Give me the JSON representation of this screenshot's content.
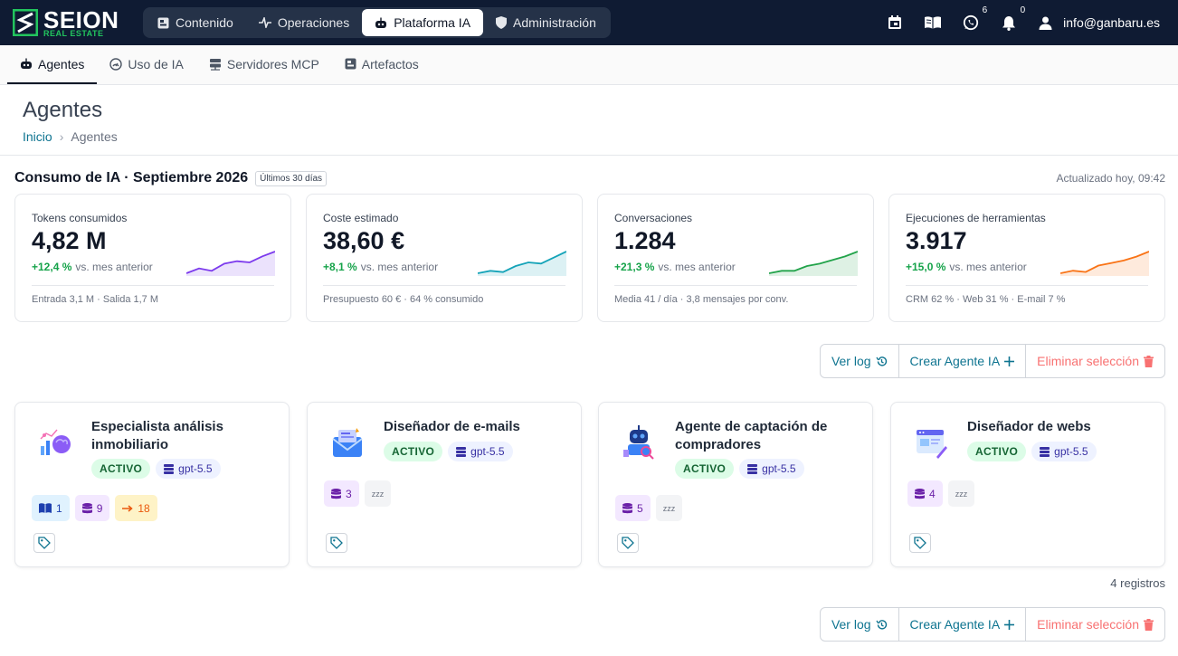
{
  "brand": {
    "name": "SEION",
    "tagline": "REAL ESTATE",
    "accent": "#22c55e"
  },
  "topnav": [
    {
      "label": "Contenido",
      "icon": "content-icon"
    },
    {
      "label": "Operaciones",
      "icon": "pulse-icon"
    },
    {
      "label": "Plataforma IA",
      "icon": "robot-icon",
      "active": true
    },
    {
      "label": "Administración",
      "icon": "shield-icon"
    }
  ],
  "topbar": {
    "whatsapp_count": "6",
    "notifications_count": "0",
    "user_email": "info@ganbaru.es"
  },
  "subnav": [
    {
      "label": "Agentes",
      "active": true
    },
    {
      "label": "Uso de IA"
    },
    {
      "label": "Servidores MCP"
    },
    {
      "label": "Artefactos"
    }
  ],
  "page": {
    "title": "Agentes",
    "breadcrumb": {
      "home": "Inicio",
      "current": "Agentes"
    }
  },
  "usage": {
    "title": "Consumo de IA · Septiembre 2026",
    "period": "Últimos 30 días",
    "updated": "Actualizado hoy, 09:42",
    "stats": [
      {
        "label": "Tokens consumidos",
        "value": "4,82 M",
        "delta": "+12,4 %",
        "delta_text": "vs. mes anterior",
        "foot": "Entrada 3,1 M · Salida 1,7 M",
        "color": "#7c3aed",
        "trend": [
          2,
          4,
          3,
          6,
          7,
          6.5,
          9,
          11
        ]
      },
      {
        "label": "Coste estimado",
        "value": "38,60 €",
        "delta": "+8,1 %",
        "delta_text": "vs. mes anterior",
        "foot": "Presupuesto 60 € · 64 % consumido",
        "color": "#14a3b8",
        "trend": [
          2,
          3,
          2.5,
          5,
          6.5,
          6,
          8.5,
          11
        ]
      },
      {
        "label": "Conversaciones",
        "value": "1.284",
        "delta": "+21,3 %",
        "delta_text": "vs. mes anterior",
        "foot": "Media 41 / día · 3,8 mensajes por conv.",
        "color": "#22a34a",
        "trend": [
          1,
          2,
          2,
          4,
          5,
          6.5,
          8,
          10
        ]
      },
      {
        "label": "Ejecuciones de herramientas",
        "value": "3.917",
        "delta": "+15,0 %",
        "delta_text": "vs. mes anterior",
        "foot": "CRM 62 % · Web 31 % · E-mail 7 %",
        "color": "#f97316",
        "trend": [
          2,
          3,
          2.5,
          5,
          6,
          7,
          8.5,
          10.5
        ]
      }
    ]
  },
  "actions": {
    "log": "Ver log",
    "create": "Crear Agente IA",
    "delete": "Eliminar selección"
  },
  "agents": [
    {
      "name": "Especialista análisis inmobiliario",
      "status": "ACTIVO",
      "model": "gpt-5.5",
      "chips": [
        {
          "type": "blue",
          "icon": "book-icon",
          "value": "1"
        },
        {
          "type": "purple",
          "icon": "database-icon",
          "value": "9"
        },
        {
          "type": "orange",
          "icon": "arrow-icon",
          "value": "18"
        }
      ]
    },
    {
      "name": "Diseñador de e-mails",
      "status": "ACTIVO",
      "model": "gpt-5.5",
      "chips": [
        {
          "type": "purple",
          "icon": "database-icon",
          "value": "3"
        },
        {
          "type": "gray",
          "icon": "sleep-icon",
          "value": "zzz"
        }
      ]
    },
    {
      "name": "Agente de captación de compradores",
      "status": "ACTIVO",
      "model": "gpt-5.5",
      "chips": [
        {
          "type": "purple",
          "icon": "database-icon",
          "value": "5"
        },
        {
          "type": "gray",
          "icon": "sleep-icon",
          "value": "zzz"
        }
      ]
    },
    {
      "name": "Diseñador de webs",
      "status": "ACTIVO",
      "model": "gpt-5.5",
      "chips": [
        {
          "type": "purple",
          "icon": "database-icon",
          "value": "4"
        },
        {
          "type": "gray",
          "icon": "sleep-icon",
          "value": "zzz"
        }
      ]
    }
  ],
  "records": "4 registros"
}
